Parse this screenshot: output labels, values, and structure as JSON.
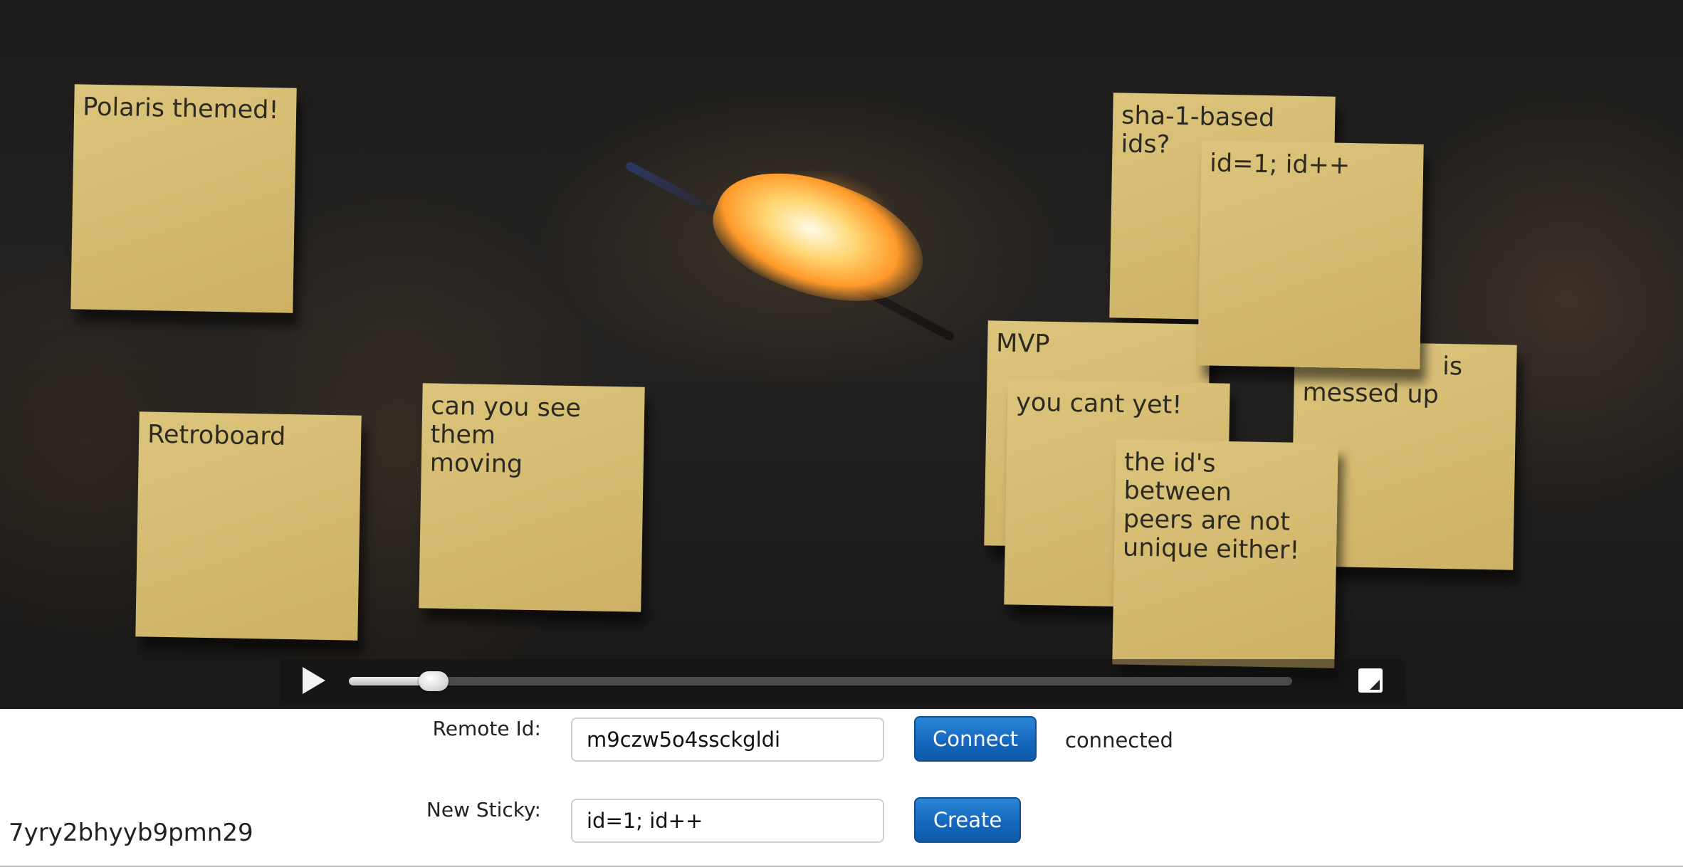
{
  "stickies": [
    {
      "lines": [
        "Polaris themed!"
      ]
    },
    {
      "lines": [
        "Retroboard"
      ]
    },
    {
      "lines": [
        "can you see them",
        "moving"
      ]
    },
    {
      "lines": [
        "sha-1-based ids?"
      ]
    },
    {
      "lines": [
        "MVP"
      ]
    },
    {
      "lines": [
        "",
        "messed up"
      ],
      "partial_tail": "is"
    },
    {
      "lines": [
        "id=1; id++"
      ]
    },
    {
      "lines": [
        "you cant yet!"
      ]
    },
    {
      "lines": [
        "the id's between",
        "peers are not",
        "unique either!"
      ]
    }
  ],
  "video": {
    "progress_fraction": 0.09,
    "play_icon": "play-icon",
    "fullscreen_icon": "fullscreen-icon"
  },
  "form": {
    "remote_id_label": "Remote Id:",
    "remote_id_value": "m9czw5o4ssckgldi",
    "connect_label": "Connect",
    "status_text": "connected",
    "new_sticky_label": "New Sticky:",
    "new_sticky_value": "id=1; id++",
    "create_label": "Create"
  },
  "own_peer_id": "7yry2bhyyb9pmn29",
  "colors": {
    "sticky": "#d6bd72",
    "button": "#1a6fc4",
    "text": "#222222"
  }
}
